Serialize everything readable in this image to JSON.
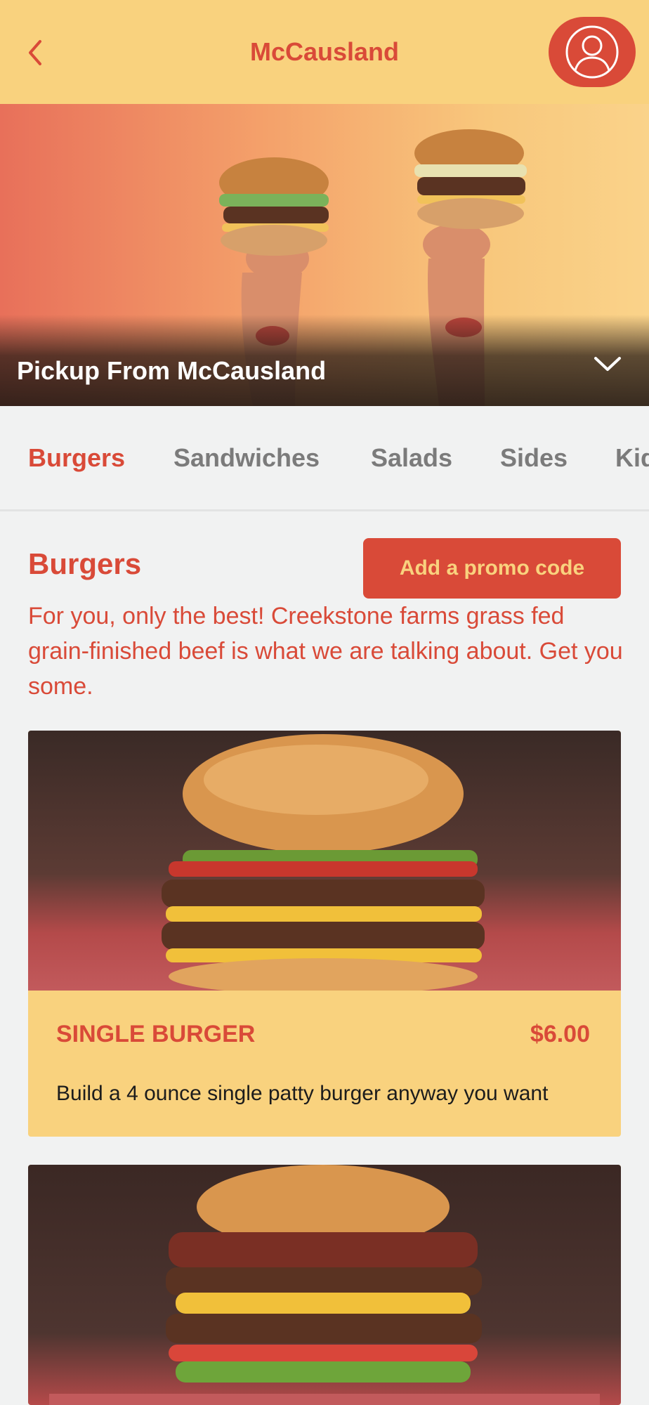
{
  "header": {
    "title": "McCausland",
    "back_icon": "chevron-left-icon",
    "profile_icon": "user-icon"
  },
  "hero": {
    "label": "Pickup From McCausland",
    "chevron_icon": "chevron-down-icon"
  },
  "tabs": [
    {
      "label": "Burgers",
      "active": true
    },
    {
      "label": "Sandwiches",
      "active": false
    },
    {
      "label": "Salads",
      "active": false
    },
    {
      "label": "Sides",
      "active": false
    },
    {
      "label": "Kids",
      "active": false
    }
  ],
  "section": {
    "title": "Burgers",
    "promo_label": "Add a promo code",
    "description": "For you, only the best! Creekstone farms grass fed grain-finished beef is what we are talking about. Get you some."
  },
  "items": [
    {
      "name": "SINGLE BURGER",
      "price": "$6.00",
      "description": "Build a 4 ounce single patty burger anyway you want"
    },
    {
      "name": "",
      "price": "",
      "description": ""
    }
  ],
  "colors": {
    "accent": "#d94a38",
    "header_bg": "#f9d27e",
    "card_bg": "#f9d27e",
    "page_bg": "#f1f2f2"
  }
}
